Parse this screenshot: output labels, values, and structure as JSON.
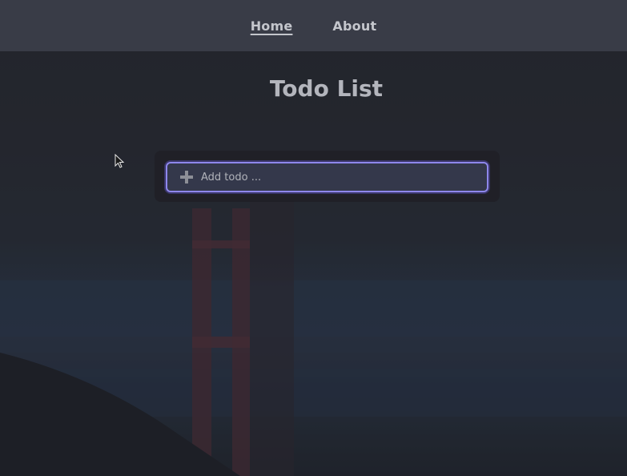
{
  "nav": {
    "links": [
      {
        "label": "Home",
        "active": true
      },
      {
        "label": "About",
        "active": false
      }
    ]
  },
  "main": {
    "title": "Todo List",
    "add_todo": {
      "placeholder": "Add todo ...",
      "value": "",
      "icon": "plus-icon"
    }
  },
  "colors": {
    "navbar_bg": "#393c47",
    "page_bg": "#262830",
    "input_focus_border": "#8e87ec",
    "title_color": "#b3b5bc"
  }
}
